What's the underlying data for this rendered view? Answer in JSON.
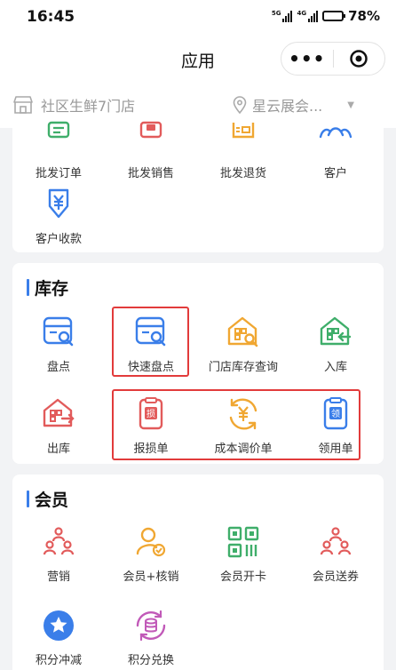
{
  "status": {
    "time": "16:45",
    "sig1": "5G",
    "sig2": "4G",
    "battery": "78%"
  },
  "nav": {
    "title": "应用",
    "more": "•••"
  },
  "store": {
    "name": "社区生鲜7门店",
    "location": "星云展会..."
  },
  "wholesale": {
    "items": [
      {
        "label": "批发订单",
        "icon": "clipboard-list-icon",
        "color": "#3fae6a"
      },
      {
        "label": "批发销售",
        "icon": "sales-doc-icon",
        "color": "#e25b5b"
      },
      {
        "label": "批发退货",
        "icon": "return-doc-icon",
        "color": "#f0a732"
      },
      {
        "label": "客户",
        "icon": "customers-icon",
        "color": "#3a7ee9"
      },
      {
        "label": "客户收款",
        "icon": "yen-receipt-icon",
        "color": "#3a7ee9"
      }
    ]
  },
  "inventory": {
    "title": "库存",
    "items": [
      {
        "label": "盘点",
        "icon": "stocktake-icon",
        "color": "#3a7ee9"
      },
      {
        "label": "快速盘点",
        "icon": "quick-stocktake-icon",
        "color": "#3a7ee9"
      },
      {
        "label": "门店库存查询",
        "icon": "store-stock-query-icon",
        "color": "#f0a732"
      },
      {
        "label": "入库",
        "icon": "stock-in-icon",
        "color": "#3fae6a"
      },
      {
        "label": "出库",
        "icon": "stock-out-icon",
        "color": "#e25b5b"
      },
      {
        "label": "报损单",
        "icon": "loss-report-icon",
        "color": "#e25b5b",
        "badge": "损"
      },
      {
        "label": "成本调价单",
        "icon": "cost-adjust-icon",
        "color": "#f0a732"
      },
      {
        "label": "领用单",
        "icon": "requisition-icon",
        "color": "#3a7ee9",
        "badge": "领"
      }
    ]
  },
  "member": {
    "title": "会员",
    "items": [
      {
        "label": "营销",
        "icon": "marketing-icon",
        "color": "#e25b5b"
      },
      {
        "label": "会员+核销",
        "icon": "member-verify-icon",
        "color": "#f0a732"
      },
      {
        "label": "会员开卡",
        "icon": "member-card-icon",
        "color": "#3fae6a"
      },
      {
        "label": "会员送券",
        "icon": "member-coupon-icon",
        "color": "#e25b5b"
      },
      {
        "label": "积分冲减",
        "icon": "points-deduct-icon",
        "color": "#3a7ee9"
      },
      {
        "label": "积分兑换",
        "icon": "points-exchange-icon",
        "color": "#c159b8"
      }
    ]
  }
}
